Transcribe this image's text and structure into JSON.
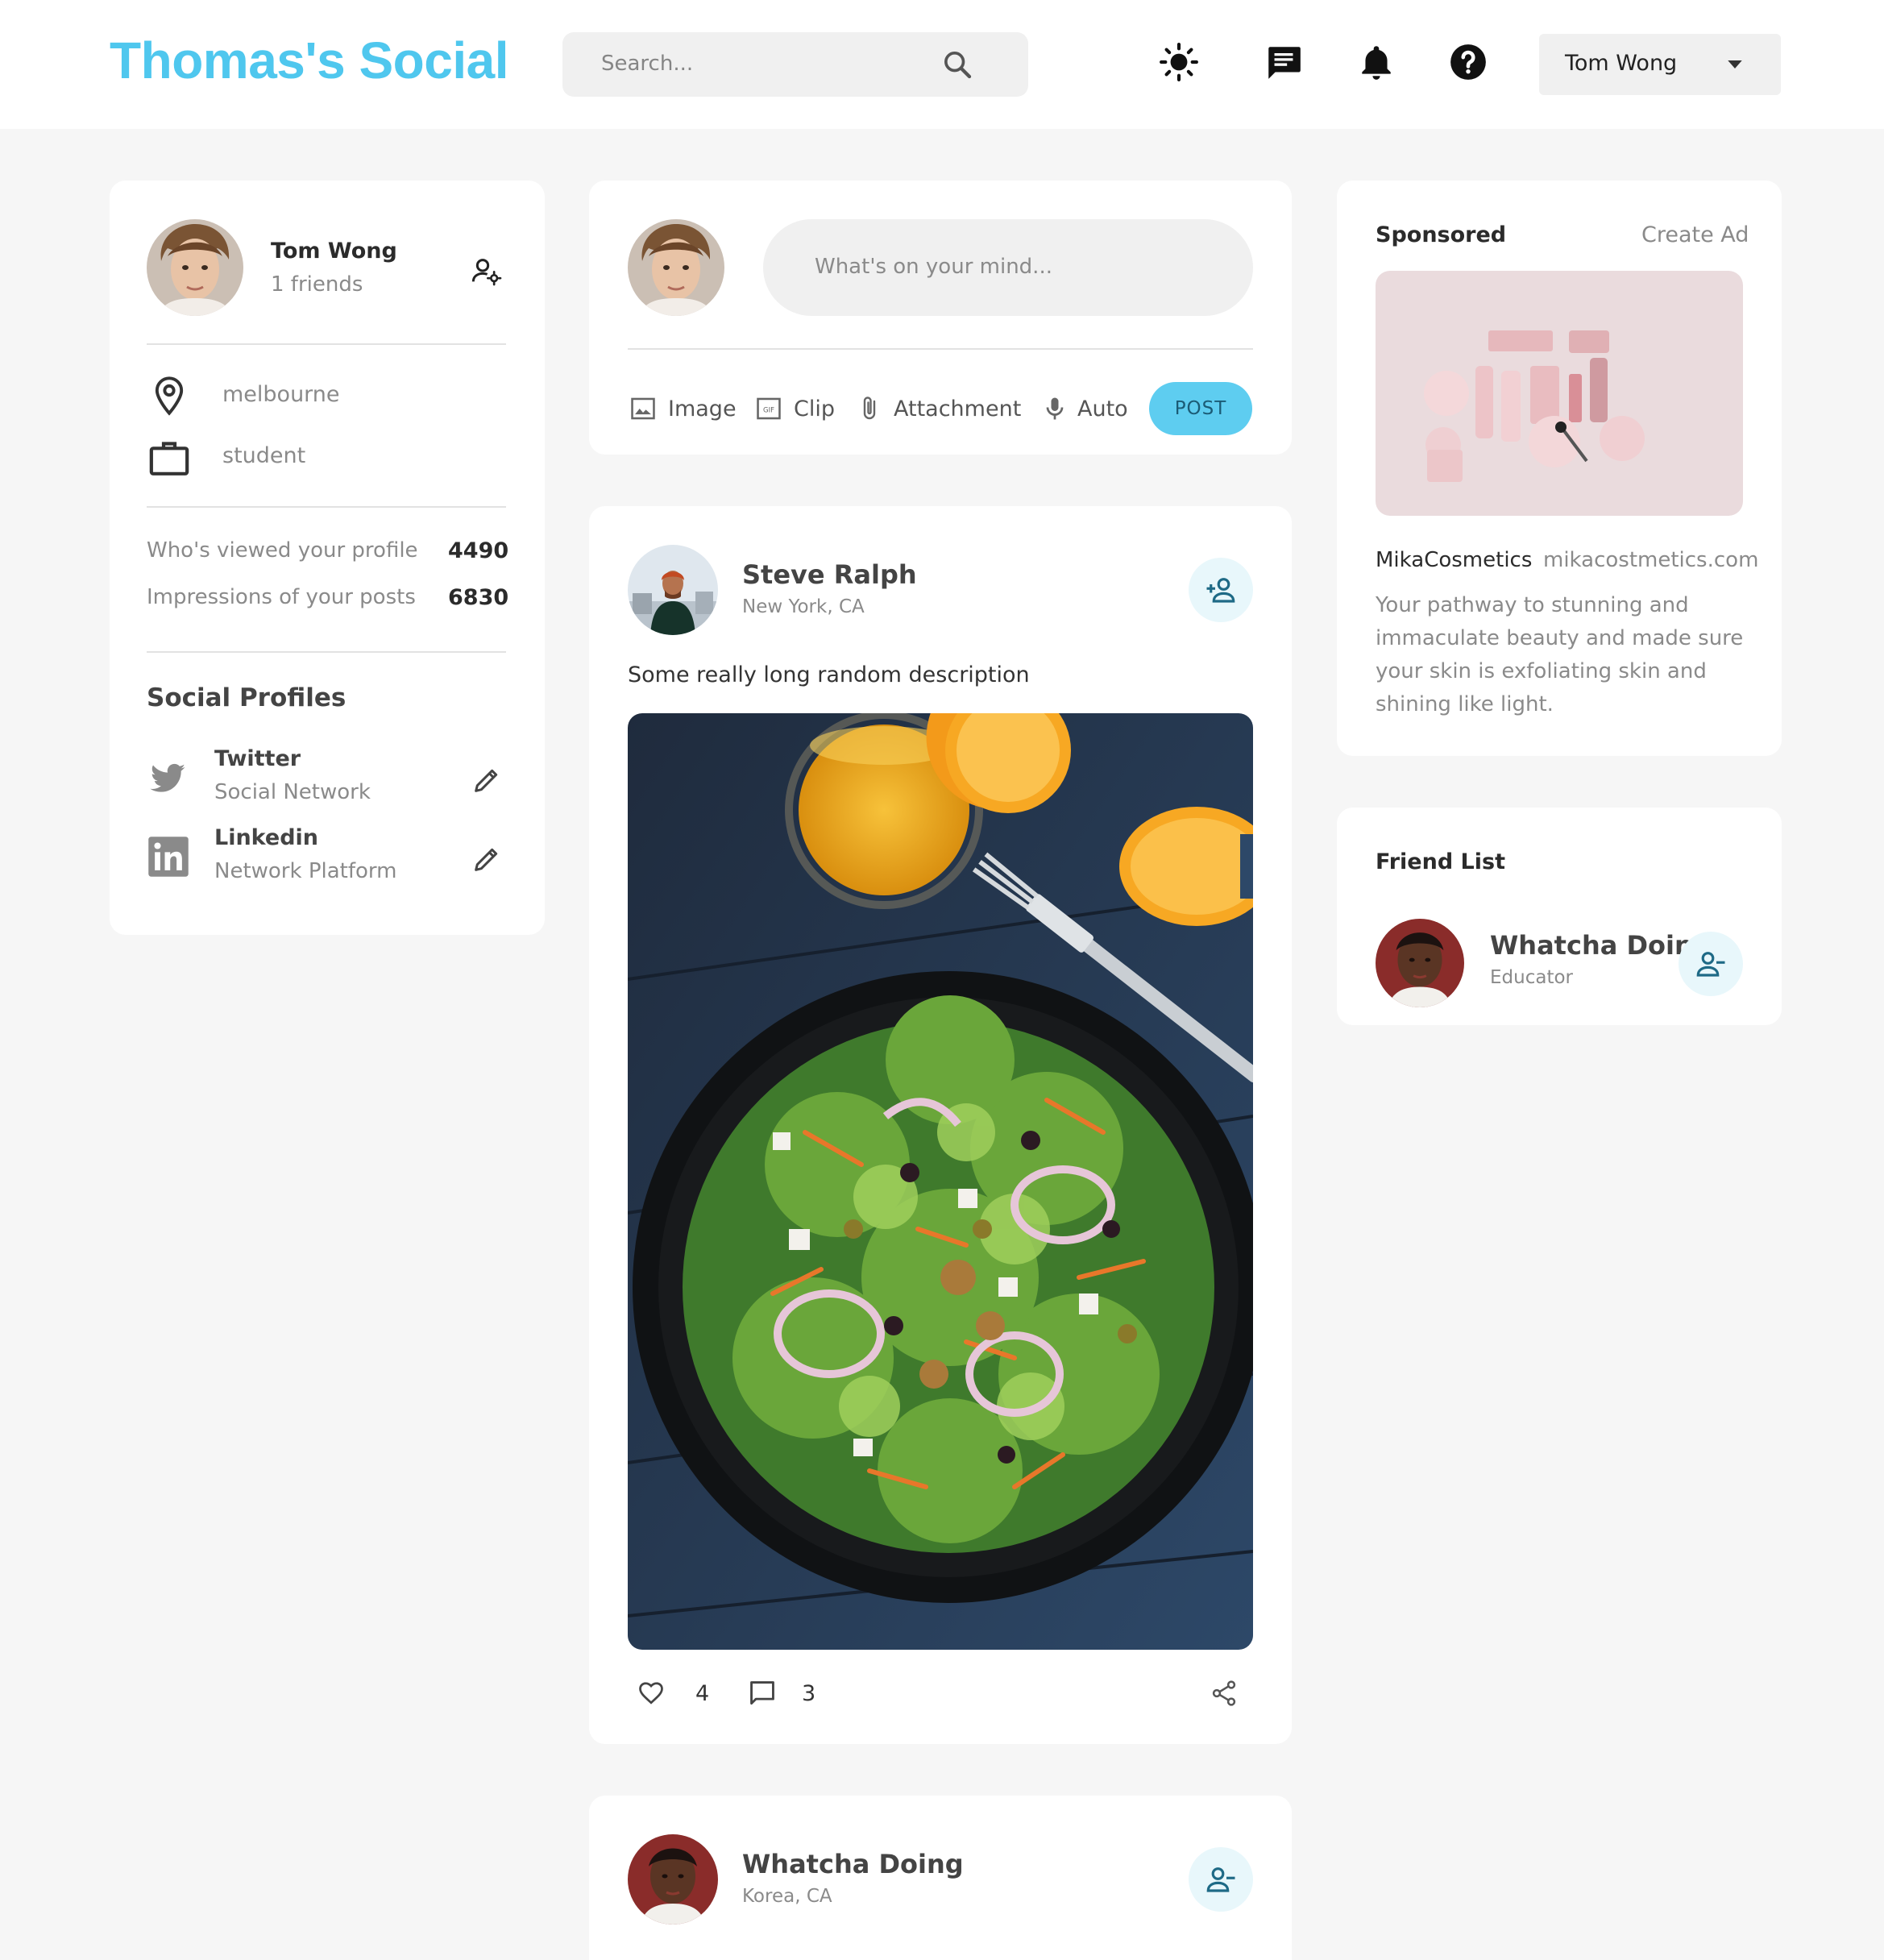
{
  "navbar": {
    "logo": "Thomas's Social",
    "search_placeholder": "Search...",
    "icons": [
      "search-icon",
      "light-mode-icon",
      "message-icon",
      "notifications-icon",
      "help-icon"
    ],
    "user_menu": {
      "name": "Tom Wong"
    }
  },
  "colors": {
    "brand": "#4fc7ee",
    "post_button": "#5ecdf0",
    "background": "#f6f6f6",
    "card": "#ffffff"
  },
  "profile": {
    "name": "Tom Wong",
    "friends": "1 friends",
    "location": "melbourne",
    "occupation": "student",
    "stats": [
      {
        "label": "Who's viewed your profile",
        "value": "4490"
      },
      {
        "label": "Impressions of your posts",
        "value": "6830"
      }
    ],
    "social_title": "Social Profiles",
    "socials": [
      {
        "name": "Twitter",
        "desc": "Social Network",
        "icon": "twitter-icon"
      },
      {
        "name": "Linkedin",
        "desc": "Network Platform",
        "icon": "linkedin-icon"
      }
    ]
  },
  "composer": {
    "placeholder": "What's on your mind...",
    "actions": [
      {
        "label": "Image",
        "icon": "image-icon"
      },
      {
        "label": "Clip",
        "icon": "gif-icon"
      },
      {
        "label": "Attachment",
        "icon": "attachment-icon"
      },
      {
        "label": "Auto",
        "icon": "microphone-icon"
      }
    ],
    "post_label": "POST"
  },
  "posts": [
    {
      "author": "Steve Ralph",
      "location": "New York, CA",
      "description": "Some really long random description",
      "likes": "4",
      "comments": "3"
    },
    {
      "author": "Whatcha Doing",
      "location": "Korea, CA"
    }
  ],
  "sponsored": {
    "title": "Sponsored",
    "create_ad": "Create Ad",
    "brand": "MikaCosmetics",
    "url": "mikacostmetics.com",
    "lines": [
      "Your pathway to stunning and",
      "immaculate beauty and made sure",
      "your skin is exfoliating skin and",
      "shining like light."
    ]
  },
  "friends": {
    "title": "Friend List",
    "items": [
      {
        "name": "Whatcha Doing",
        "role": "Educator"
      }
    ]
  }
}
